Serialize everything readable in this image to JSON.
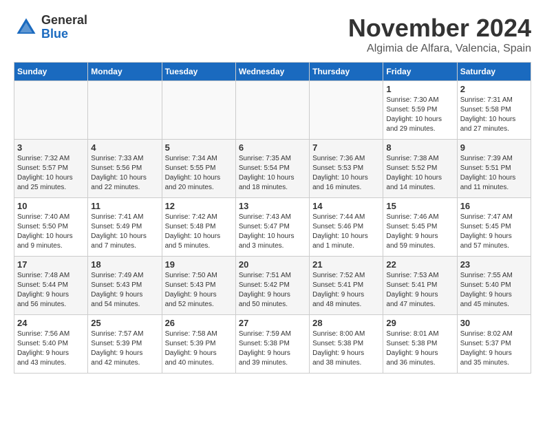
{
  "header": {
    "logo_general": "General",
    "logo_blue": "Blue",
    "month_title": "November 2024",
    "location": "Algimia de Alfara, Valencia, Spain"
  },
  "days_of_week": [
    "Sunday",
    "Monday",
    "Tuesday",
    "Wednesday",
    "Thursday",
    "Friday",
    "Saturday"
  ],
  "weeks": [
    {
      "row_class": "row-odd",
      "days": [
        {
          "date": "",
          "empty": true
        },
        {
          "date": "",
          "empty": true
        },
        {
          "date": "",
          "empty": true
        },
        {
          "date": "",
          "empty": true
        },
        {
          "date": "",
          "empty": true
        },
        {
          "date": "1",
          "info": "Sunrise: 7:30 AM\nSunset: 5:59 PM\nDaylight: 10 hours\nand 29 minutes."
        },
        {
          "date": "2",
          "info": "Sunrise: 7:31 AM\nSunset: 5:58 PM\nDaylight: 10 hours\nand 27 minutes."
        }
      ]
    },
    {
      "row_class": "row-even",
      "days": [
        {
          "date": "3",
          "info": "Sunrise: 7:32 AM\nSunset: 5:57 PM\nDaylight: 10 hours\nand 25 minutes."
        },
        {
          "date": "4",
          "info": "Sunrise: 7:33 AM\nSunset: 5:56 PM\nDaylight: 10 hours\nand 22 minutes."
        },
        {
          "date": "5",
          "info": "Sunrise: 7:34 AM\nSunset: 5:55 PM\nDaylight: 10 hours\nand 20 minutes."
        },
        {
          "date": "6",
          "info": "Sunrise: 7:35 AM\nSunset: 5:54 PM\nDaylight: 10 hours\nand 18 minutes."
        },
        {
          "date": "7",
          "info": "Sunrise: 7:36 AM\nSunset: 5:53 PM\nDaylight: 10 hours\nand 16 minutes."
        },
        {
          "date": "8",
          "info": "Sunrise: 7:38 AM\nSunset: 5:52 PM\nDaylight: 10 hours\nand 14 minutes."
        },
        {
          "date": "9",
          "info": "Sunrise: 7:39 AM\nSunset: 5:51 PM\nDaylight: 10 hours\nand 11 minutes."
        }
      ]
    },
    {
      "row_class": "row-odd",
      "days": [
        {
          "date": "10",
          "info": "Sunrise: 7:40 AM\nSunset: 5:50 PM\nDaylight: 10 hours\nand 9 minutes."
        },
        {
          "date": "11",
          "info": "Sunrise: 7:41 AM\nSunset: 5:49 PM\nDaylight: 10 hours\nand 7 minutes."
        },
        {
          "date": "12",
          "info": "Sunrise: 7:42 AM\nSunset: 5:48 PM\nDaylight: 10 hours\nand 5 minutes."
        },
        {
          "date": "13",
          "info": "Sunrise: 7:43 AM\nSunset: 5:47 PM\nDaylight: 10 hours\nand 3 minutes."
        },
        {
          "date": "14",
          "info": "Sunrise: 7:44 AM\nSunset: 5:46 PM\nDaylight: 10 hours\nand 1 minute."
        },
        {
          "date": "15",
          "info": "Sunrise: 7:46 AM\nSunset: 5:45 PM\nDaylight: 9 hours\nand 59 minutes."
        },
        {
          "date": "16",
          "info": "Sunrise: 7:47 AM\nSunset: 5:45 PM\nDaylight: 9 hours\nand 57 minutes."
        }
      ]
    },
    {
      "row_class": "row-even",
      "days": [
        {
          "date": "17",
          "info": "Sunrise: 7:48 AM\nSunset: 5:44 PM\nDaylight: 9 hours\nand 56 minutes."
        },
        {
          "date": "18",
          "info": "Sunrise: 7:49 AM\nSunset: 5:43 PM\nDaylight: 9 hours\nand 54 minutes."
        },
        {
          "date": "19",
          "info": "Sunrise: 7:50 AM\nSunset: 5:43 PM\nDaylight: 9 hours\nand 52 minutes."
        },
        {
          "date": "20",
          "info": "Sunrise: 7:51 AM\nSunset: 5:42 PM\nDaylight: 9 hours\nand 50 minutes."
        },
        {
          "date": "21",
          "info": "Sunrise: 7:52 AM\nSunset: 5:41 PM\nDaylight: 9 hours\nand 48 minutes."
        },
        {
          "date": "22",
          "info": "Sunrise: 7:53 AM\nSunset: 5:41 PM\nDaylight: 9 hours\nand 47 minutes."
        },
        {
          "date": "23",
          "info": "Sunrise: 7:55 AM\nSunset: 5:40 PM\nDaylight: 9 hours\nand 45 minutes."
        }
      ]
    },
    {
      "row_class": "row-odd",
      "days": [
        {
          "date": "24",
          "info": "Sunrise: 7:56 AM\nSunset: 5:40 PM\nDaylight: 9 hours\nand 43 minutes."
        },
        {
          "date": "25",
          "info": "Sunrise: 7:57 AM\nSunset: 5:39 PM\nDaylight: 9 hours\nand 42 minutes."
        },
        {
          "date": "26",
          "info": "Sunrise: 7:58 AM\nSunset: 5:39 PM\nDaylight: 9 hours\nand 40 minutes."
        },
        {
          "date": "27",
          "info": "Sunrise: 7:59 AM\nSunset: 5:38 PM\nDaylight: 9 hours\nand 39 minutes."
        },
        {
          "date": "28",
          "info": "Sunrise: 8:00 AM\nSunset: 5:38 PM\nDaylight: 9 hours\nand 38 minutes."
        },
        {
          "date": "29",
          "info": "Sunrise: 8:01 AM\nSunset: 5:38 PM\nDaylight: 9 hours\nand 36 minutes."
        },
        {
          "date": "30",
          "info": "Sunrise: 8:02 AM\nSunset: 5:37 PM\nDaylight: 9 hours\nand 35 minutes."
        }
      ]
    }
  ]
}
